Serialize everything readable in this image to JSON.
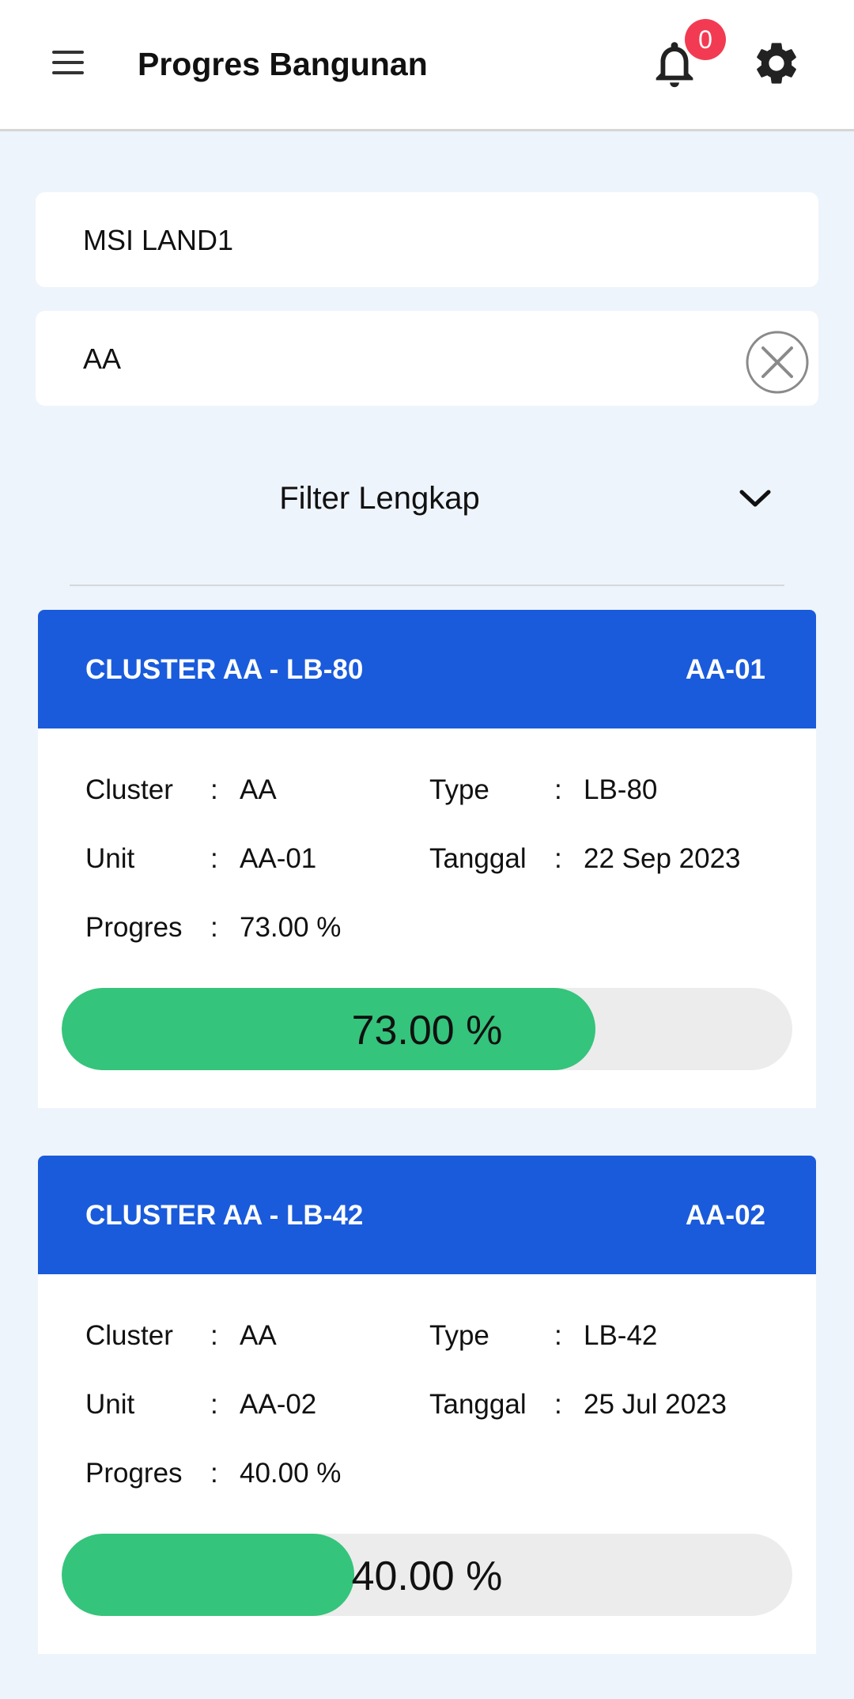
{
  "appbar": {
    "title": "Progres Bangunan",
    "notification_count": "0",
    "icons": [
      "menu-icon",
      "bell-icon",
      "gear-icon"
    ]
  },
  "filters": {
    "project_value": "MSI LAND1",
    "cluster_value": "AA",
    "advanced_label": "Filter Lengkap"
  },
  "labels": {
    "cluster": "Cluster",
    "type": "Type",
    "unit": "Unit",
    "tanggal": "Tanggal",
    "progres": "Progres",
    "sep": ":"
  },
  "cards": [
    {
      "header_title": "CLUSTER AA - LB-80",
      "header_unit": "AA-01",
      "cluster": "AA",
      "type": "LB-80",
      "unit": "AA-01",
      "tanggal": "22 Sep 2023",
      "progres": "73.00 %",
      "progress_value": 73.0
    },
    {
      "header_title": "CLUSTER AA - LB-42",
      "header_unit": "AA-02",
      "cluster": "AA",
      "type": "LB-42",
      "unit": "AA-02",
      "tanggal": "25 Jul 2023",
      "progres": "40.00 %",
      "progress_value": 40.0
    }
  ],
  "colors": {
    "primary": "#1a5bdc",
    "progress": "#35c47b",
    "badge": "#f23b52",
    "background": "#eef4fb"
  }
}
